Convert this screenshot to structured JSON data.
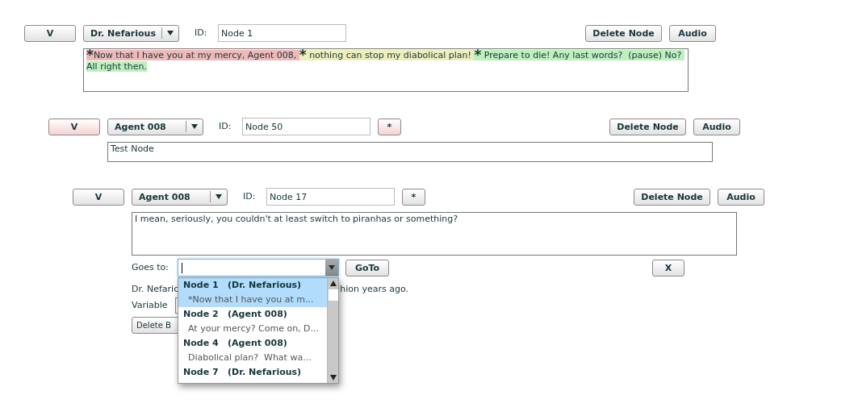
{
  "nodes": [
    {
      "toggle": "V",
      "speaker": "Dr. Nefarious",
      "id_label": "ID:",
      "id": "Node 1",
      "flagged": false,
      "delete": "Delete Node",
      "audio": "Audio",
      "segments": [
        {
          "marker": "*",
          "text": "Now that I have you at my mercy, Agent 008, ",
          "color": "#f0b9b9"
        },
        {
          "marker": "*",
          "text": " nothing can stop my diabolical plan! ",
          "color": "#efefbd"
        },
        {
          "marker": "*",
          "text": " Prepare to die! Any last words?  (pause) No? All right then.",
          "color": "#bdf0bd"
        }
      ],
      "children": [
        {
          "toggle": "V",
          "speaker": "Agent 008",
          "id_label": "ID:",
          "id": "Node 50",
          "flagged": true,
          "star_button": "*",
          "delete": "Delete Node",
          "audio": "Audio",
          "text": "Test Node",
          "children": [
            {
              "toggle": "V",
              "speaker": "Agent 008",
              "id_label": "ID:",
              "id": "Node 17",
              "flagged": false,
              "star_button": "*",
              "delete": "Delete Node",
              "audio": "Audio",
              "text": "I mean, seriously, you couldn't at least switch to piranhas or something?",
              "branch": {
                "goes_to_label": "Goes to:",
                "goto": "GoTo",
                "remove": "X",
                "condition_before": "Dr. Nefaric",
                "condition_after": "hion years ago.",
                "variable_label": "Variable",
                "delete_branch": "Delete B",
                "options": [
                  {
                    "title": "Node 1   (Dr. Nefarious)",
                    "preview": "*Now that I have you at m...",
                    "selected": true
                  },
                  {
                    "title": "Node 2   (Agent 008)",
                    "preview": "At your mercy? Come on, D...",
                    "selected": false
                  },
                  {
                    "title": "Node 4   (Agent 008)",
                    "preview": "Diabolical plan?  What wa...",
                    "selected": false
                  },
                  {
                    "title": "Node 7   (Dr. Nefarious)",
                    "selected": false
                  }
                ]
              }
            }
          ]
        }
      ]
    }
  ]
}
